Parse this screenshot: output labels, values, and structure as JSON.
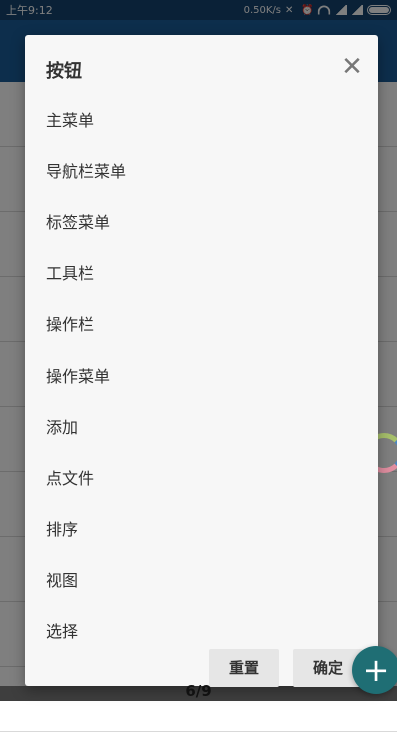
{
  "status_bar": {
    "time": "上午9:12",
    "network_speed": "0.50K/s"
  },
  "dialog": {
    "title": "按钮",
    "items": [
      {
        "label": "主菜单"
      },
      {
        "label": "导航栏菜单"
      },
      {
        "label": "标签菜单"
      },
      {
        "label": "工具栏"
      },
      {
        "label": "操作栏"
      },
      {
        "label": "操作菜单"
      },
      {
        "label": "添加"
      },
      {
        "label": "点文件"
      },
      {
        "label": "排序"
      },
      {
        "label": "视图"
      },
      {
        "label": "选择"
      }
    ],
    "reset_label": "重置",
    "confirm_label": "确定",
    "close_glyph": "✕"
  },
  "fab": {
    "glyph": "+"
  },
  "page_indicator": "6/9",
  "colors": {
    "statusbar": "#14426e",
    "header": "#1a5c98",
    "fab": "#1f6e74"
  }
}
